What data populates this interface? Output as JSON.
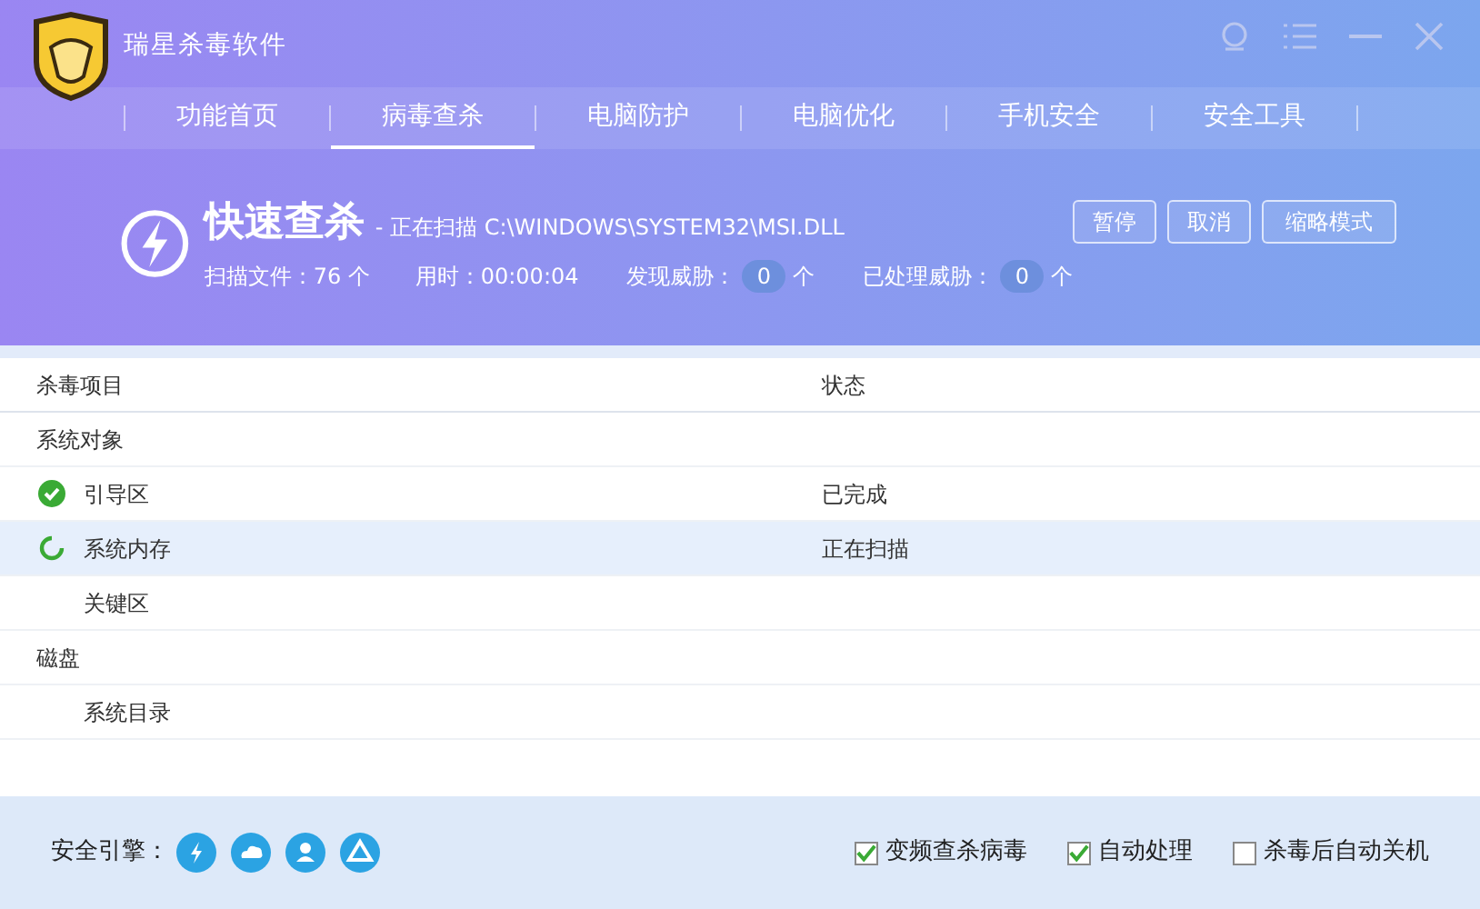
{
  "app": {
    "title": "瑞星杀毒软件"
  },
  "tabs": [
    {
      "label": "功能首页",
      "selected": false
    },
    {
      "label": "病毒查杀",
      "selected": true
    },
    {
      "label": "电脑防护",
      "selected": false
    },
    {
      "label": "电脑优化",
      "selected": false
    },
    {
      "label": "手机安全",
      "selected": false
    },
    {
      "label": "安全工具",
      "selected": false
    }
  ],
  "scan": {
    "title": "快速查杀",
    "current_file": "- 正在扫描 C:\\WINDOWS\\SYSTEM32\\MSI.DLL",
    "stats": [
      {
        "kind": "plain",
        "label": "扫描文件：76 个"
      },
      {
        "kind": "plain",
        "label": "用时：00:00:04"
      },
      {
        "kind": "badge",
        "label": "发现威胁：",
        "value": "0",
        "unit": "个"
      },
      {
        "kind": "badge",
        "label": "已处理威胁：",
        "value": "0",
        "unit": "个"
      }
    ],
    "buttons": [
      "暂停",
      "取消",
      "缩略模式"
    ]
  },
  "table": {
    "columns": [
      "杀毒项目",
      "状态"
    ],
    "groups": [
      {
        "label": "系统对象",
        "children": [
          {
            "label": "引导区",
            "kind": "done",
            "status": "已完成",
            "selected": false
          },
          {
            "label": "系统内存",
            "kind": "scanning",
            "status": "正在扫描",
            "selected": true
          },
          {
            "label": "关键区",
            "kind": "pending",
            "selected": false
          }
        ]
      },
      {
        "label": "磁盘",
        "children": [
          {
            "label": "系统目录",
            "kind": "pending",
            "selected": false
          }
        ]
      }
    ]
  },
  "footer": {
    "engine_label": "安全引擎：",
    "engines": [
      {
        "kind": "bolt"
      },
      {
        "kind": "cloud"
      },
      {
        "kind": "user"
      },
      {
        "kind": "drive"
      }
    ],
    "options": [
      {
        "label": "变频查杀病毒",
        "checked": true
      },
      {
        "label": "自动处理",
        "checked": true
      },
      {
        "label": "杀毒后自动关机",
        "checked": false
      }
    ]
  }
}
